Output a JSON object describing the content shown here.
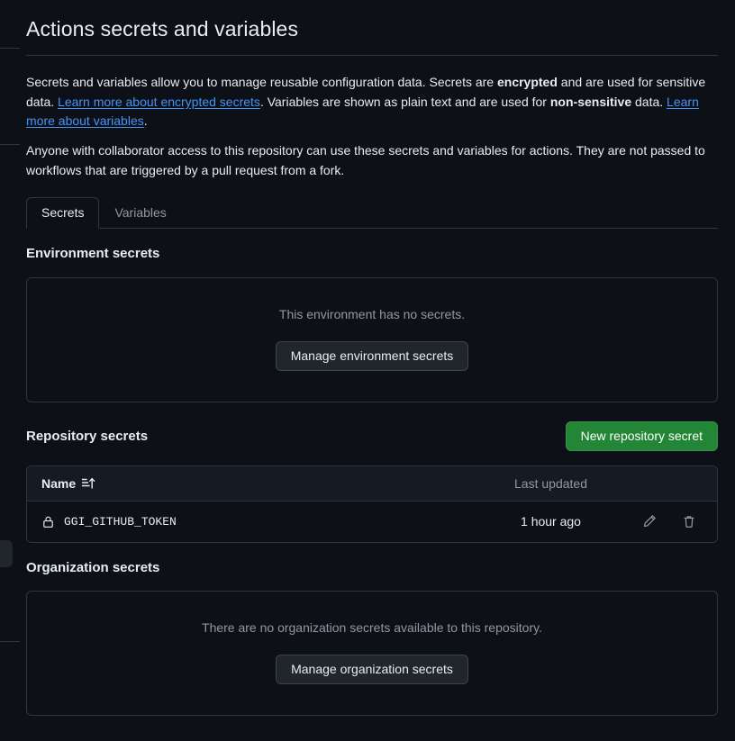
{
  "page": {
    "title": "Actions secrets and variables",
    "intro_paragraph_1": {
      "part1": "Secrets and variables allow you to manage reusable configuration data. Secrets are ",
      "bold1": "encrypted",
      "part2": " and are used for sensitive data. ",
      "link1": "Learn more about encrypted secrets",
      "part3": ". Variables are shown as plain text and are used for ",
      "bold2": "non-sensitive",
      "part4": " data. ",
      "link2": "Learn more about variables",
      "part5": "."
    },
    "intro_paragraph_2": "Anyone with collaborator access to this repository can use these secrets and variables for actions. They are not passed to workflows that are triggered by a pull request from a fork."
  },
  "tabs": [
    {
      "label": "Secrets",
      "active": true
    },
    {
      "label": "Variables",
      "active": false
    }
  ],
  "environment_secrets": {
    "heading": "Environment secrets",
    "empty_message": "This environment has no secrets.",
    "manage_button": "Manage environment secrets"
  },
  "repository_secrets": {
    "heading": "Repository secrets",
    "new_secret_button": "New repository secret",
    "columns": {
      "name": "Name",
      "last_updated": "Last updated"
    },
    "sort_icon": "sort-asc-icon",
    "rows": [
      {
        "icon": "lock-icon",
        "name": "GGI_GITHUB_TOKEN",
        "last_updated": "1 hour ago",
        "edit_icon": "pencil-icon",
        "delete_icon": "trash-icon"
      }
    ]
  },
  "organization_secrets": {
    "heading": "Organization secrets",
    "empty_message": "There are no organization secrets available to this repository.",
    "manage_button": "Manage organization secrets"
  },
  "colors": {
    "background": "#0d1117",
    "border": "#30363d",
    "accent_link": "#4493f8",
    "success_green": "#238636",
    "muted_text": "#9198a1",
    "button_bg": "#21262d"
  }
}
